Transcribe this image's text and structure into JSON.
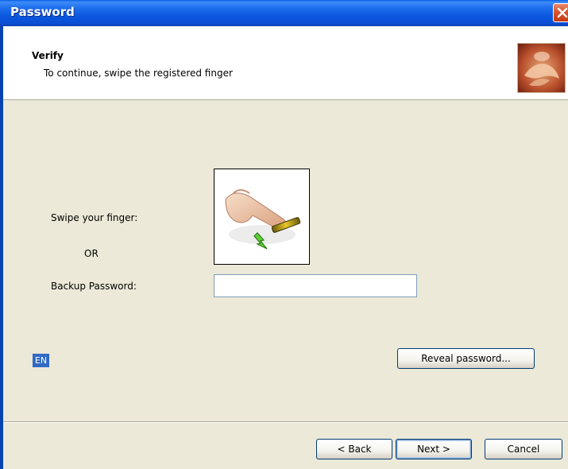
{
  "window": {
    "title": "Password"
  },
  "header": {
    "title": "Verify",
    "subtitle": "To continue, swipe the registered finger"
  },
  "form": {
    "swipe_label": "Swipe your finger:",
    "or_label": "OR",
    "password_label": "Backup Password:",
    "password_value": "",
    "reveal_button": "Reveal password..."
  },
  "status": {
    "language": "EN"
  },
  "buttons": {
    "back": "< Back",
    "next": "Next >",
    "cancel": "Cancel"
  },
  "colors": {
    "titlebar": "#0A4FD6",
    "dialog_bg": "#ECE9D8",
    "language_bg": "#316AC5",
    "close_button": "#D9542D"
  }
}
